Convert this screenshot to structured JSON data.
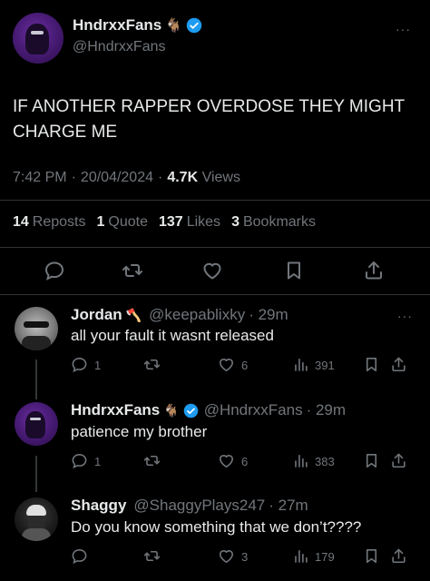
{
  "colors": {
    "background": "#000000",
    "text": "#e7e9ea",
    "muted": "#71767b",
    "verified": "#1d9bf0",
    "divider": "#2f3336"
  },
  "main_tweet": {
    "author_name": "HndrxxFans",
    "author_emoji": "🐐",
    "author_handle": "@HndrxxFans",
    "more": "···",
    "text_line1": "IF ANOTHER RAPPER OVERDOSE THEY MIGHT",
    "text_line2": "CHARGE ME",
    "time": "7:42 PM",
    "sep": "·",
    "date": "20/04/2024",
    "views_count": "4.7K",
    "views_label": "Views",
    "reposts_count": "14",
    "reposts_label": "Reposts",
    "quotes_count": "1",
    "quotes_label": "Quote",
    "likes_count": "137",
    "likes_label": "Likes",
    "bookmarks_count": "3",
    "bookmarks_label": "Bookmarks"
  },
  "replies": [
    {
      "name": "Jordan",
      "emoji": "🪓",
      "handle": "@keepablixky",
      "time": "· 29m",
      "text": "all your fault it wasnt released",
      "reply_count": "1",
      "like_count": "6",
      "views_count": "391"
    },
    {
      "name": "HndrxxFans",
      "emoji": "🐐",
      "handle": "@HndrxxFans",
      "time": "· 29m",
      "text": "patience my brother",
      "reply_count": "1",
      "like_count": "6",
      "views_count": "383"
    },
    {
      "name": "Shaggy",
      "emoji": "",
      "handle": "@ShaggyPlays247",
      "time": "· 27m",
      "text": "Do you know something that we don’t????",
      "reply_count": "",
      "like_count": "3",
      "views_count": "179"
    }
  ],
  "icons": [
    "reply-icon",
    "repost-icon",
    "like-icon",
    "bookmark-icon",
    "share-icon",
    "views-icon",
    "verified-icon",
    "more-icon"
  ]
}
